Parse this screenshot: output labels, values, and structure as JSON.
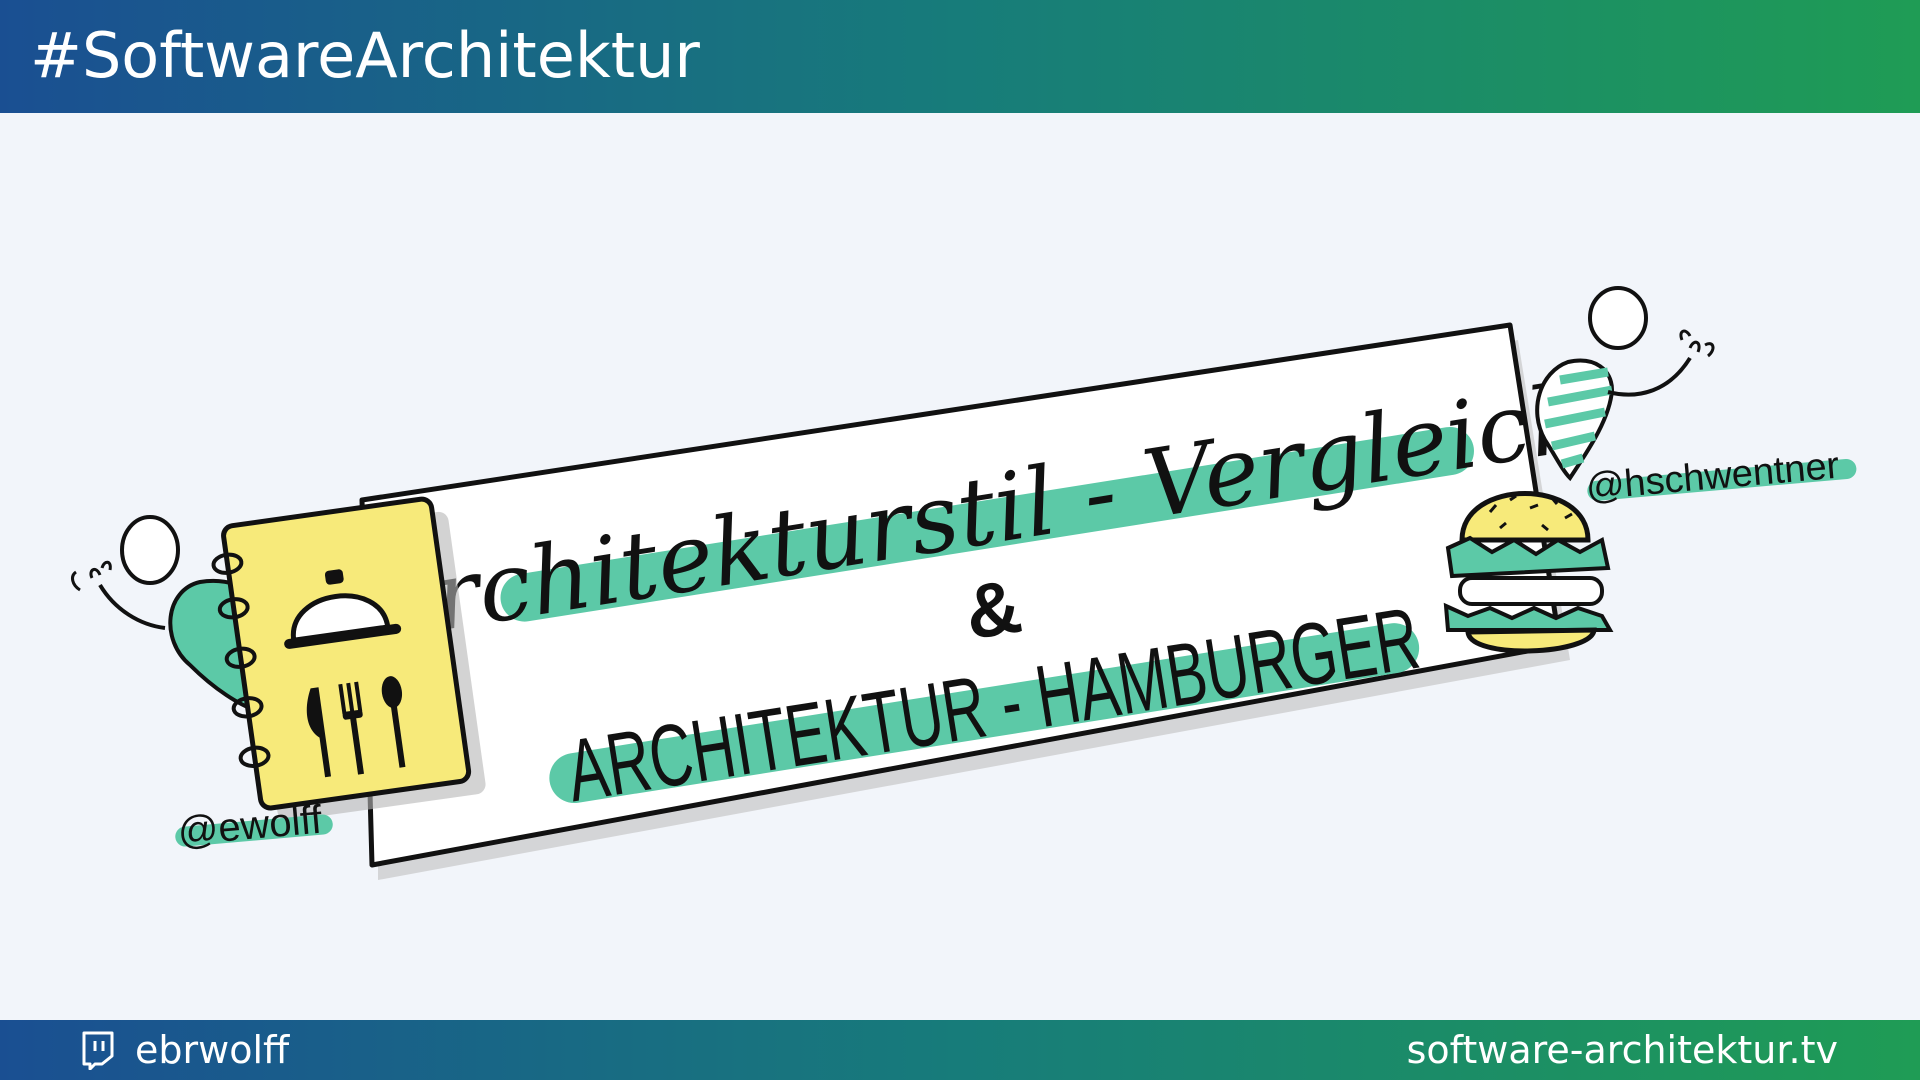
{
  "header": {
    "title": "#SoftwareArchitektur"
  },
  "footer": {
    "icon": "twitch-icon",
    "handle": "ebrwolff",
    "url": "software-architektur.tv"
  },
  "sketch": {
    "line1": "Architekturstil - Vergleich",
    "ampersand": "&",
    "line2": "ARCHITEKTUR - HAMBURGER",
    "handle_left": "@ewolff",
    "handle_right": "@hschwentner",
    "icons": [
      "menu-book-icon",
      "cloche-icon",
      "cutlery-icon",
      "hamburger-icon",
      "person-left-icon",
      "person-right-icon"
    ]
  },
  "colors": {
    "accent_teal": "#5cc9a7",
    "book_yellow": "#f7ea7a",
    "gradient_start": "#1a4f92",
    "gradient_end": "#1f9c55"
  }
}
